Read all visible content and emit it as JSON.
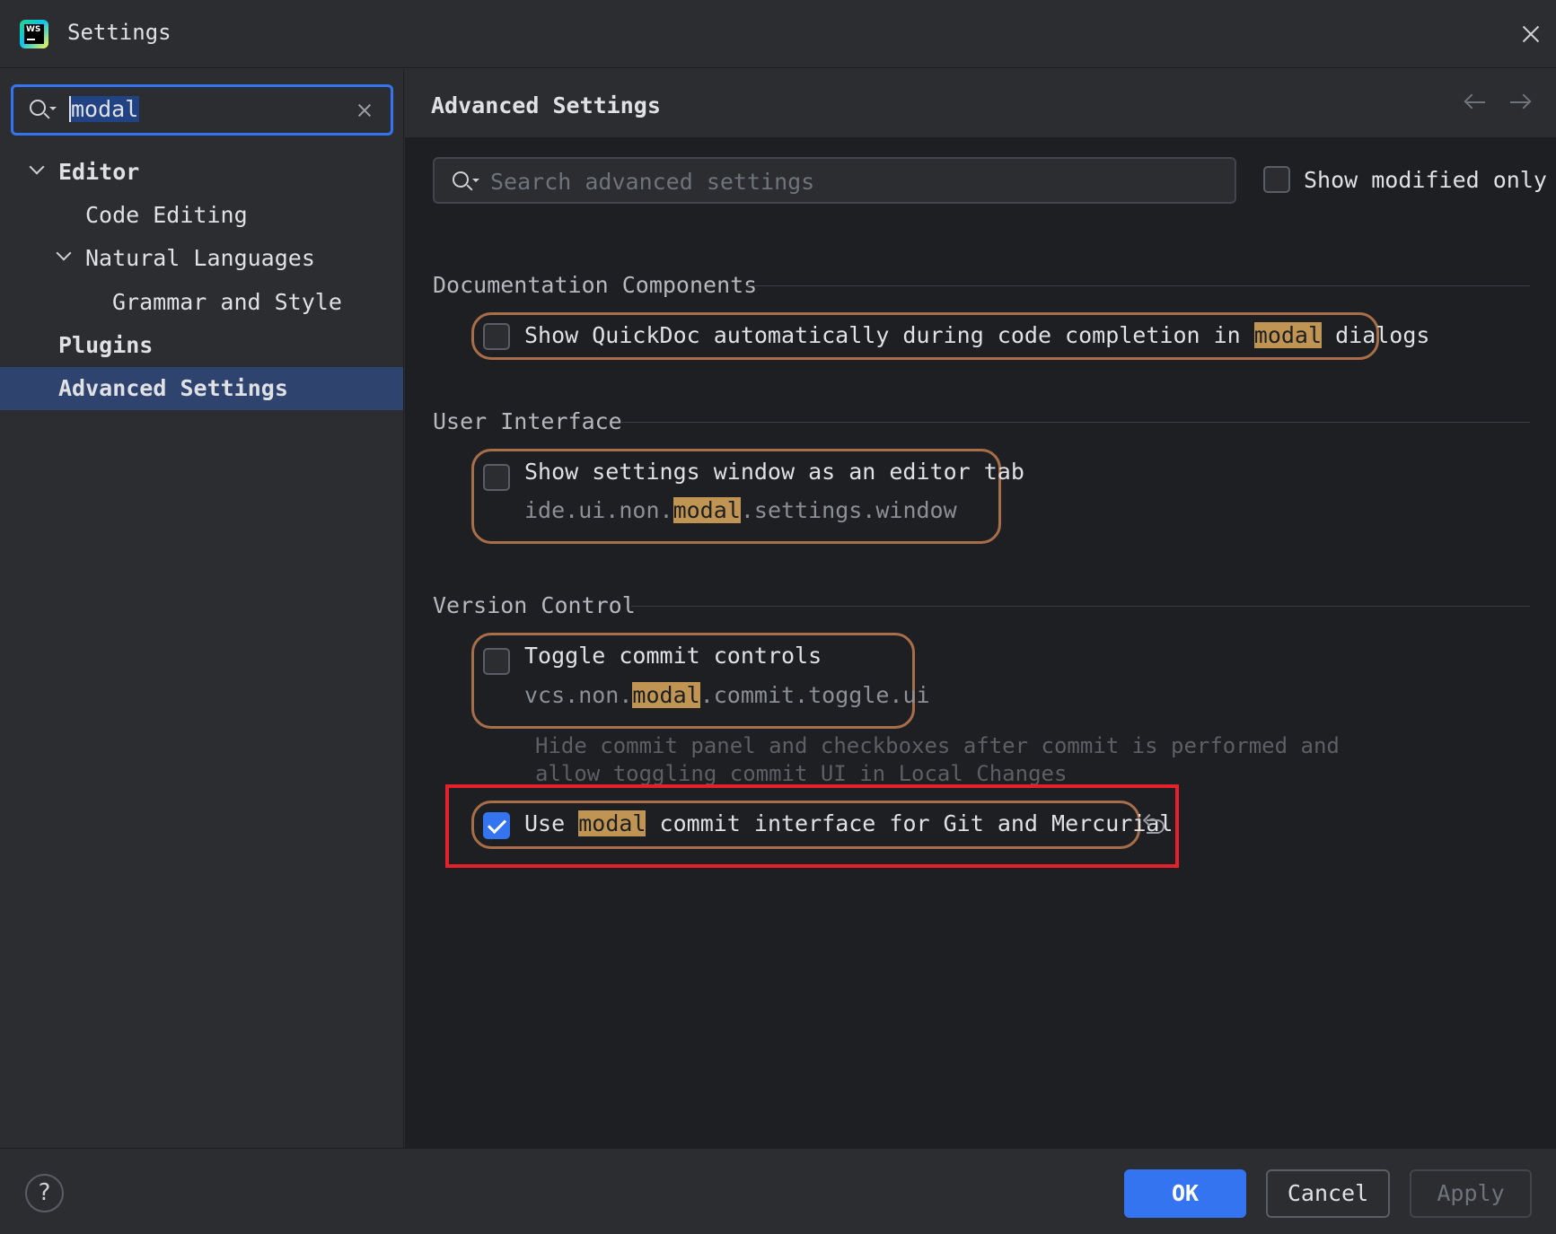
{
  "window": {
    "title": "Settings",
    "app_icon": "webstorm-logo",
    "app_icon_text": "WS"
  },
  "sidebar": {
    "search": {
      "value": "modal"
    },
    "items": [
      {
        "label": "Editor",
        "expanded": true,
        "bold": true
      },
      {
        "label": "Code Editing"
      },
      {
        "label": "Natural Languages",
        "expanded": true
      },
      {
        "label": "Grammar and Style"
      },
      {
        "label": "Plugins",
        "bold": true
      },
      {
        "label": "Advanced Settings",
        "bold": true,
        "selected": true
      }
    ]
  },
  "main": {
    "title": "Advanced Settings",
    "search_placeholder": "Search advanced settings",
    "show_modified_only": {
      "label": "Show modified only",
      "checked": false
    },
    "groups": [
      {
        "title": "Documentation Components",
        "options": [
          {
            "label_pre": "Show QuickDoc automatically during code completion in ",
            "label_hl": "modal",
            "label_post": " dialogs",
            "checked": false
          }
        ]
      },
      {
        "title": "User Interface",
        "options": [
          {
            "label": "Show settings window as an editor tab",
            "key_pre": "ide.ui.non.",
            "key_hl": "modal",
            "key_post": ".settings.window",
            "checked": false
          }
        ]
      },
      {
        "title": "Version Control",
        "options": [
          {
            "label": "Toggle commit controls",
            "key_pre": "vcs.non.",
            "key_hl": "modal",
            "key_post": ".commit.toggle.ui",
            "checked": false,
            "description": "Hide commit panel and checkboxes after commit is performed and allow toggling commit UI in Local Changes"
          },
          {
            "label_pre": "Use ",
            "label_hl": "modal",
            "label_post": " commit interface for Git and Mercurial",
            "checked": true,
            "modified": true
          }
        ]
      }
    ]
  },
  "footer": {
    "help": "?",
    "ok": "OK",
    "cancel": "Cancel",
    "apply": "Apply",
    "apply_enabled": false
  },
  "colors": {
    "accent": "#3574f0",
    "match_highlight": "#c09553",
    "match_outline": "#a86e4a",
    "annotation_red": "#e4202b"
  }
}
